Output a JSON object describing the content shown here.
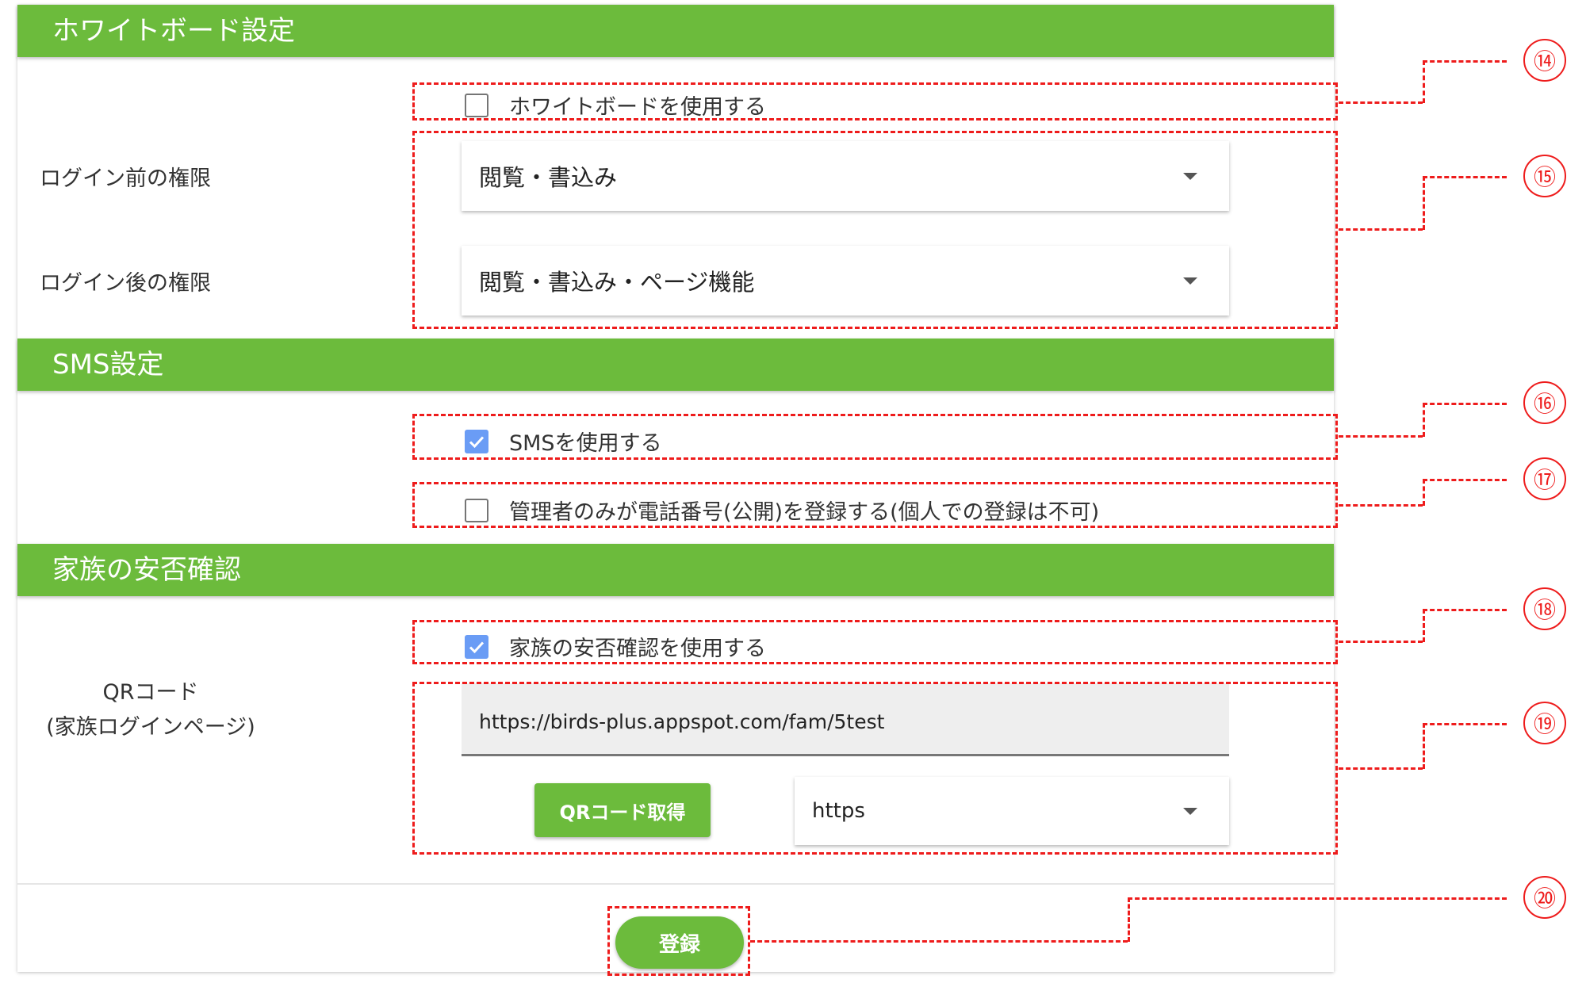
{
  "whiteboard": {
    "header": "ホワイトボード設定",
    "use_label": "ホワイトボードを使用する",
    "use_checked": false,
    "before_login_label": "ログイン前の権限",
    "before_login_value": "閲覧・書込み",
    "after_login_label": "ログイン後の権限",
    "after_login_value": "閲覧・書込み・ページ機能"
  },
  "sms": {
    "header": "SMS設定",
    "use_label": "SMSを使用する",
    "use_checked": true,
    "admin_only_label": "管理者のみが電話番号(公開)を登録する(個人での登録は不可)",
    "admin_only_checked": false
  },
  "family": {
    "header": "家族の安否確認",
    "use_label": "家族の安否確認を使用する",
    "use_checked": true,
    "qr_label_line1": "QRコード",
    "qr_label_line2": "(家族ログインページ)",
    "url_value": "https://birds-plus.appspot.com/fam/5test",
    "qr_button": "QRコード取得",
    "protocol_value": "https"
  },
  "footer": {
    "submit_button": "登録"
  },
  "callouts": {
    "c14": "⑭",
    "c15": "⑮",
    "c16": "⑯",
    "c17": "⑰",
    "c18": "⑱",
    "c19": "⑲",
    "c20": "⑳"
  },
  "colors": {
    "accent_green": "#6cbb3c",
    "checkbox_blue": "#6a9cf5",
    "annotation_red": "#ee1c1c"
  }
}
